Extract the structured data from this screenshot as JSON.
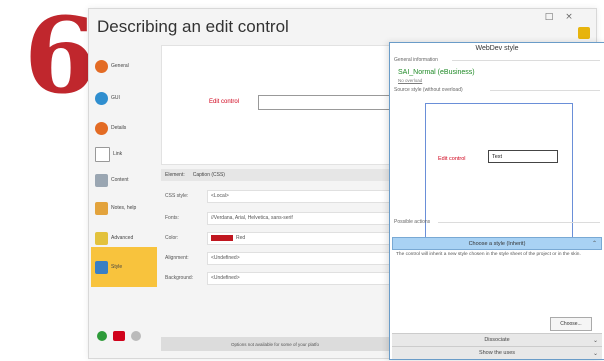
{
  "step_number": "6",
  "window": {
    "title": "Describing an edit control",
    "minimize_label": "□",
    "close_label": "×"
  },
  "sidebar": {
    "items": [
      {
        "label": "General",
        "icon": "general-icon"
      },
      {
        "label": "GUI",
        "icon": "gui-icon"
      },
      {
        "label": "Details",
        "icon": "details-icon"
      },
      {
        "label": "Link",
        "icon": "link-icon"
      },
      {
        "label": "Content",
        "icon": "content-icon"
      },
      {
        "label": "Notes, help",
        "icon": "notes-help-icon"
      },
      {
        "label": "Advanced",
        "icon": "advanced-icon"
      },
      {
        "label": "Style",
        "icon": "style-icon"
      }
    ]
  },
  "preview": {
    "edit_label": "Edit control"
  },
  "element": {
    "label": "Element:",
    "value": "Caption (CSS)"
  },
  "properties": [
    {
      "label": "CSS style:",
      "value": "<Local>"
    },
    {
      "label": "Fonts:",
      "value": "//Verdana, Arial, Helvetica, sans-serif"
    },
    {
      "label": "Color:",
      "value": "Red"
    },
    {
      "label": "Alignment:",
      "value": "<Undefined>"
    },
    {
      "label": "Background:",
      "value": "<Undefined>"
    }
  ],
  "bottom_bar": {
    "text": "Options not available for some of your platfo"
  },
  "webdev_panel": {
    "title": "WebDev style",
    "general_information": "General information",
    "style_name": "SAI_Normal (eBusiness)",
    "no_override": "No overload",
    "source_style": "Source style (without overload)",
    "source_edit_label": "Edit control",
    "source_input_value": "Text",
    "possible_actions": "Possible actions",
    "choose_style": "Choose a style (Inherit)",
    "description": "The control will inherit a new style chosen in the style sheet of the project or in the skin.",
    "choose_button": "Choose...",
    "dissociate": "Dissociate",
    "show_uses": "Show the uses"
  },
  "colors": {
    "accent": "#f8c33d",
    "big_number": "#c0272d",
    "red_label": "#d0021b",
    "panel_border": "#6a9cc8"
  }
}
